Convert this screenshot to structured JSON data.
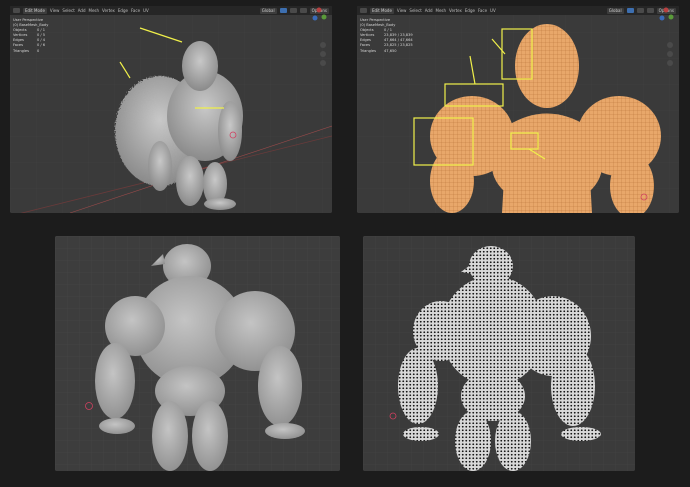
{
  "colors": {
    "page_background": "#1c1c1c",
    "viewport": "#3a3a3a",
    "sculpt": "#b2b2b2",
    "edit_selection": "#e8a76a",
    "annotation_yellow": "#f0f04a",
    "x_axis": "#b04444"
  },
  "viewports": [
    {
      "header": {
        "mode": "Edit Mode",
        "menus": [
          "View",
          "Select",
          "Add",
          "Mesh",
          "Vertex",
          "Edge",
          "Face",
          "UV"
        ],
        "transform": "Global",
        "options": "Options"
      },
      "overlay_title": "User Perspective",
      "overlay_subtitle": "(0) BaseMesh_Body",
      "stats": [
        {
          "label": "Objects",
          "value": "0 / 1"
        },
        {
          "label": "Vertices",
          "value": "0 / 5"
        },
        {
          "label": "Edges",
          "value": "0 / 4"
        },
        {
          "label": "Faces",
          "value": "0 / 6"
        },
        {
          "label": "Triangles",
          "value": "0"
        }
      ]
    },
    {
      "header": {
        "mode": "Edit Mode",
        "menus": [
          "View",
          "Select",
          "Add",
          "Mesh",
          "Vertex",
          "Edge",
          "Face",
          "UV"
        ],
        "transform": "Global",
        "options": "Options"
      },
      "overlay_title": "User Perspective",
      "overlay_subtitle": "(0) BaseMesh_Body",
      "stats": [
        {
          "label": "Objects",
          "value": "0 / 1"
        },
        {
          "label": "Vertices",
          "value": "23,839 / 23,839"
        },
        {
          "label": "Edges",
          "value": "47,664 / 47,664"
        },
        {
          "label": "Faces",
          "value": "23,825 / 23,825"
        },
        {
          "label": "Triangles",
          "value": "47,650"
        }
      ]
    },
    {
      "view": "Sculpt back view"
    },
    {
      "view": "Wireframe back view"
    }
  ],
  "icons": [
    "editor-type-icon",
    "navigation-gizmo-icon",
    "zoom-icon",
    "pan-icon",
    "camera-icon",
    "3d-cursor-icon"
  ]
}
